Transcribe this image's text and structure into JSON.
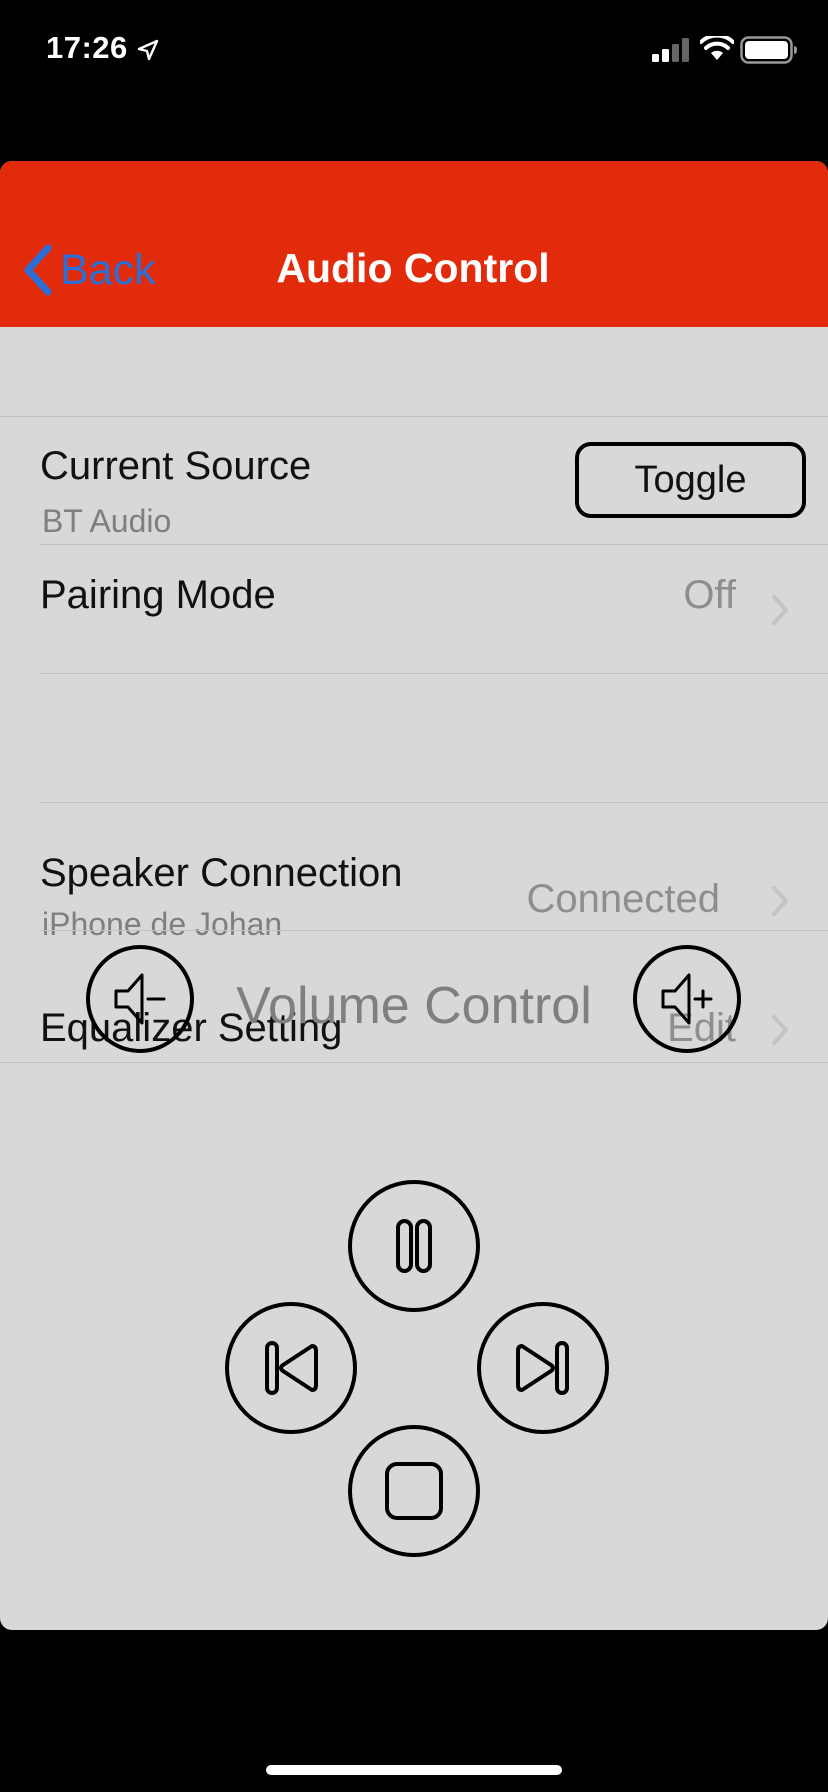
{
  "status_bar": {
    "time": "17:26",
    "icons": [
      "location-arrow-icon",
      "signal-icon",
      "wifi-icon",
      "battery-icon"
    ]
  },
  "nav": {
    "back_label": "Back",
    "title": "Audio Control",
    "bar_color": "#e22b0a",
    "back_color": "#2a6fd8"
  },
  "rows": {
    "current_source": {
      "title": "Current Source",
      "subtitle": "BT Audio",
      "button_label": "Toggle"
    },
    "pairing_mode": {
      "title": "Pairing Mode",
      "value": "Off"
    },
    "speaker_connection": {
      "title": "Speaker Connection",
      "subtitle": "iPhone de Johan",
      "value": "Connected"
    },
    "equalizer_setting": {
      "title": "Equalizer Setting",
      "value": "Edit"
    }
  },
  "volume": {
    "label": "Volume Control",
    "icons": [
      "volume-down-icon",
      "volume-up-icon"
    ]
  },
  "playback": {
    "icons": [
      "pause-icon",
      "previous-track-icon",
      "next-track-icon",
      "stop-icon"
    ]
  }
}
